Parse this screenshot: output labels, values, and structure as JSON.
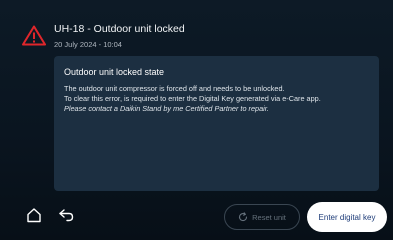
{
  "error": {
    "title": "UH-18 - Outdoor unit locked",
    "timestamp": "20 July 2024 - 10:04",
    "icon": "warning-triangle-icon",
    "icon_color": "#e0262b"
  },
  "card": {
    "title": "Outdoor unit locked state",
    "body_line_1": "The outdoor unit compressor is forced off and needs to be unlocked.",
    "body_line_2": "To clear this error, is required to enter the Digital Key generated via e-Care app.",
    "body_line_3": "Please contact a Daikin Stand by me Certified Partner to repair."
  },
  "nav": {
    "home_icon": "home-icon",
    "back_icon": "back-arrow-icon",
    "reset_label": "Reset unit",
    "reset_icon": "reset-icon",
    "enter_key_label": "Enter digital key"
  },
  "colors": {
    "background": "#0a1520",
    "card": "#1c2f41",
    "primary_button": "#ffffff",
    "primary_button_text": "#1d3b78"
  }
}
